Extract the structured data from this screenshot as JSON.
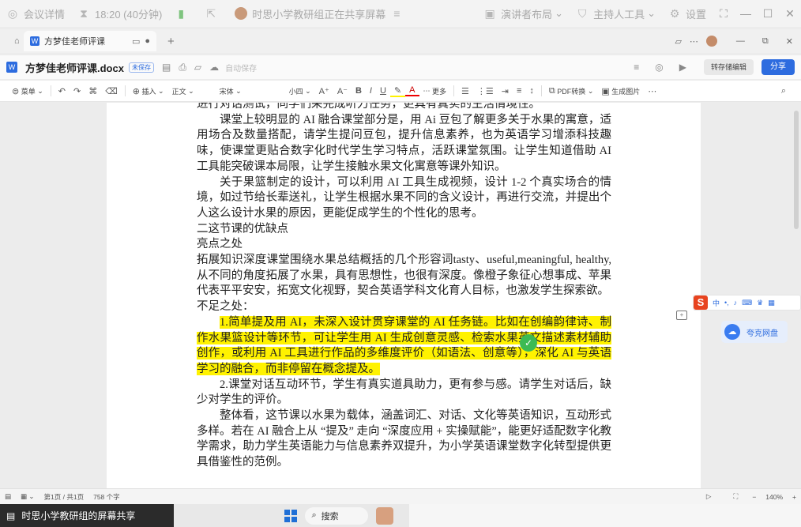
{
  "meeting": {
    "details_label": "会议详情",
    "timer": "18:20 (40分钟)",
    "sharing_status": "时思小学教研组正在共享屏幕",
    "presenter_layout": "演讲者布局",
    "host_tools": "主持人工具",
    "settings": "设置"
  },
  "tab": {
    "title": "方梦佳老师评课"
  },
  "document": {
    "file_name": "方梦佳老师评课.docx",
    "cloud_tag": "未保存",
    "auto_save": "自动保存",
    "convert_label": "转存储编辑",
    "share_label": "分享"
  },
  "ribbon": {
    "menu": "菜单",
    "insert": "插入",
    "style": "正文",
    "font": "宋体",
    "size": "小四",
    "more": "更多",
    "pdf": "PDF转换",
    "gen_image": "生成图片"
  },
  "paragraphs": [
    {
      "text": "进行对话测试，同学们采完成听力任务，更具有真实的生活情境性。",
      "indent": false,
      "highlight": false
    },
    {
      "text": "课堂上较明显的 AI 融合课堂部分是，用 Ai 豆包了解更多关于水果的寓意，适用场合及数量搭配，请学生提问豆包，提升信息素养，也为英语学习增添科技趣味，使课堂更贴合数字化时代学生学习特点，活跃课堂氛围。让学生知道借助 AI 工具能突破课本局限，让学生接触水果文化寓意等课外知识。",
      "indent": true,
      "highlight": false
    },
    {
      "text": "关于果篮制定的设计，可以利用 AI 工具生成视频，设计 1-2 个真实场合的情境，如过节给长辈送礼，让学生根据水果不同的含义设计，再进行交流，并提出个人这么设计水果的原因，更能促成学生的个性化的思考。",
      "indent": true,
      "highlight": false
    },
    {
      "text": "二这节课的优缺点",
      "indent": false,
      "highlight": false
    },
    {
      "text": "亮点之处",
      "indent": false,
      "highlight": false
    },
    {
      "text": "拓展知识深度课堂围绕水果总结概括的几个形容词tasty、useful,meaningful, healthy,从不同的角度拓展了水果，具有思想性，也很有深度。像橙子象征心想事成、苹果代表平平安安，拓宽文化视野，契合英语学科文化育人目标，也激发学生探索欲。",
      "indent": false,
      "highlight": false
    },
    {
      "text": "不足之处：",
      "indent": false,
      "highlight": false
    },
    {
      "text": "1.简单提及用 AI，未深入设计贯穿课堂的 AI 任务链。比如在创编韵律诗、制作水果篮设计等环节，可让学生用 AI 生成创意灵感、检索水果英文描述素材辅助创作，或利用 AI 工具进行作品的多维度评价（如语法、创意等），深化 AI 与英语学习的融合，而非停留在概念提及。",
      "indent": true,
      "highlight": true
    },
    {
      "text": "2.课堂对话互动环节，学生有真实道具助力，更有参与感。请学生对话后，缺少对学生的评价。",
      "indent": true,
      "highlight": false
    },
    {
      "text": "整体看，这节课以水果为载体，涵盖词汇、对话、文化等英语知识，互动形式多样。若在 AI 融合上从 “提及” 走向 “深度应用 + 实操赋能”，能更好适配数字化教学需求，助力学生英语能力与信息素养双提升，为小学英语课堂数字化转型提供更具借鉴性的范例。",
      "indent": true,
      "highlight": false
    }
  ],
  "side": {
    "cloud_drive": "夸克网盘",
    "ime_mode": "中"
  },
  "status": {
    "page_info": "第1页 / 共1页",
    "word_count": "758 个字",
    "zoom": "140%"
  },
  "taskbar": {
    "share_label": "时思小学教研组的屏幕共享",
    "search_label": "搜索"
  },
  "colors": {
    "accent": "#2d6cdf",
    "highlight": "#fff200",
    "share_pill": "#2b2b2b"
  }
}
